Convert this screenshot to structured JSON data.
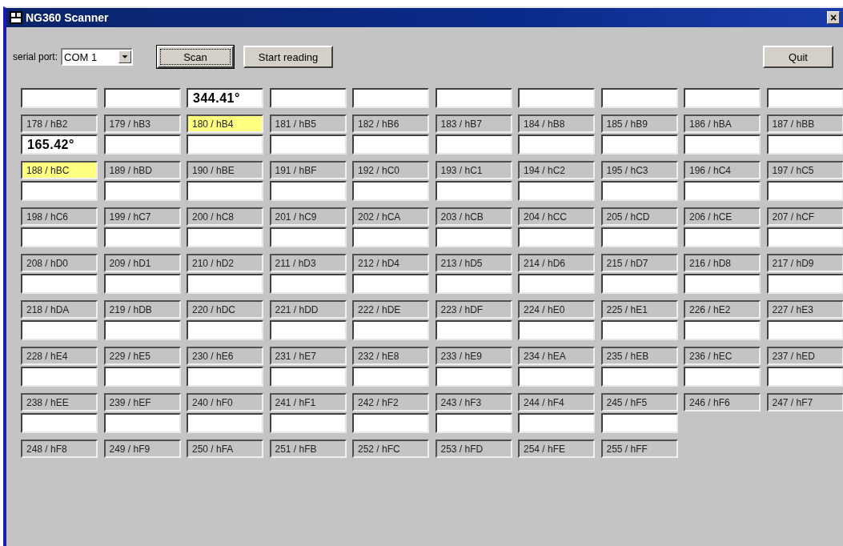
{
  "window": {
    "title": "NG360 Scanner",
    "close": "×"
  },
  "toolbar": {
    "port_label": "serial port:",
    "port_value": "COM 1",
    "scan": "Scan",
    "start": "Start reading",
    "quit": "Quit"
  },
  "cells": [
    {
      "label": "178 / hB2",
      "highlighted": false
    },
    {
      "label": "179 / hB3",
      "highlighted": false
    },
    {
      "label": "180 / hB4",
      "value": "344.41°",
      "highlighted": true
    },
    {
      "label": "181 / hB5",
      "highlighted": false
    },
    {
      "label": "182 / hB6",
      "highlighted": false
    },
    {
      "label": "183 / hB7",
      "highlighted": false
    },
    {
      "label": "184 / hB8",
      "highlighted": false
    },
    {
      "label": "185 / hB9",
      "highlighted": false
    },
    {
      "label": "186 / hBA",
      "highlighted": false
    },
    {
      "label": "187 / hBB",
      "highlighted": false
    },
    {
      "label": "188 / hBC",
      "value": "165.42°",
      "highlighted": true
    },
    {
      "label": "189 / hBD",
      "highlighted": false
    },
    {
      "label": "190 / hBE",
      "highlighted": false
    },
    {
      "label": "191 / hBF",
      "highlighted": false
    },
    {
      "label": "192 / hC0",
      "highlighted": false
    },
    {
      "label": "193 / hC1",
      "highlighted": false
    },
    {
      "label": "194 / hC2",
      "highlighted": false
    },
    {
      "label": "195 / hC3",
      "highlighted": false
    },
    {
      "label": "196 / hC4",
      "highlighted": false
    },
    {
      "label": "197 / hC5",
      "highlighted": false
    },
    {
      "label": "198 / hC6",
      "highlighted": false
    },
    {
      "label": "199 / hC7",
      "highlighted": false
    },
    {
      "label": "200 / hC8",
      "highlighted": false
    },
    {
      "label": "201 / hC9",
      "highlighted": false
    },
    {
      "label": "202 / hCA",
      "highlighted": false
    },
    {
      "label": "203 / hCB",
      "highlighted": false
    },
    {
      "label": "204 / hCC",
      "highlighted": false
    },
    {
      "label": "205 / hCD",
      "highlighted": false
    },
    {
      "label": "206 / hCE",
      "highlighted": false
    },
    {
      "label": "207 / hCF",
      "highlighted": false
    },
    {
      "label": "208 / hD0",
      "highlighted": false
    },
    {
      "label": "209 / hD1",
      "highlighted": false
    },
    {
      "label": "210 / hD2",
      "highlighted": false
    },
    {
      "label": "211 / hD3",
      "highlighted": false
    },
    {
      "label": "212 / hD4",
      "highlighted": false
    },
    {
      "label": "213 / hD5",
      "highlighted": false
    },
    {
      "label": "214 / hD6",
      "highlighted": false
    },
    {
      "label": "215 / hD7",
      "highlighted": false
    },
    {
      "label": "216 / hD8",
      "highlighted": false
    },
    {
      "label": "217 / hD9",
      "highlighted": false
    },
    {
      "label": "218 / hDA",
      "highlighted": false
    },
    {
      "label": "219 / hDB",
      "highlighted": false
    },
    {
      "label": "220 / hDC",
      "highlighted": false
    },
    {
      "label": "221 / hDD",
      "highlighted": false
    },
    {
      "label": "222 / hDE",
      "highlighted": false
    },
    {
      "label": "223 / hDF",
      "highlighted": false
    },
    {
      "label": "224 / hE0",
      "highlighted": false
    },
    {
      "label": "225 / hE1",
      "highlighted": false
    },
    {
      "label": "226 / hE2",
      "highlighted": false
    },
    {
      "label": "227 / hE3",
      "highlighted": false
    },
    {
      "label": "228 / hE4",
      "highlighted": false
    },
    {
      "label": "229 / hE5",
      "highlighted": false
    },
    {
      "label": "230 / hE6",
      "highlighted": false
    },
    {
      "label": "231 / hE7",
      "highlighted": false
    },
    {
      "label": "232 / hE8",
      "highlighted": false
    },
    {
      "label": "233 / hE9",
      "highlighted": false
    },
    {
      "label": "234 / hEA",
      "highlighted": false
    },
    {
      "label": "235 / hEB",
      "highlighted": false
    },
    {
      "label": "236 / hEC",
      "highlighted": false
    },
    {
      "label": "237 / hED",
      "highlighted": false
    },
    {
      "label": "238 / hEE",
      "highlighted": false
    },
    {
      "label": "239 / hEF",
      "highlighted": false
    },
    {
      "label": "240 / hF0",
      "highlighted": false
    },
    {
      "label": "241 / hF1",
      "highlighted": false
    },
    {
      "label": "242 / hF2",
      "highlighted": false
    },
    {
      "label": "243 / hF3",
      "highlighted": false
    },
    {
      "label": "244 / hF4",
      "highlighted": false
    },
    {
      "label": "245 / hF5",
      "highlighted": false
    },
    {
      "label": "246 / hF6",
      "highlighted": false
    },
    {
      "label": "247 / hF7",
      "highlighted": false
    },
    {
      "label": "248 / hF8",
      "highlighted": false
    },
    {
      "label": "249 / hF9",
      "highlighted": false
    },
    {
      "label": "250 / hFA",
      "highlighted": false
    },
    {
      "label": "251 / hFB",
      "highlighted": false
    },
    {
      "label": "252 / hFC",
      "highlighted": false
    },
    {
      "label": "253 / hFD",
      "highlighted": false
    },
    {
      "label": "254 / hFE",
      "highlighted": false
    },
    {
      "label": "255 / hFF",
      "highlighted": false
    }
  ]
}
